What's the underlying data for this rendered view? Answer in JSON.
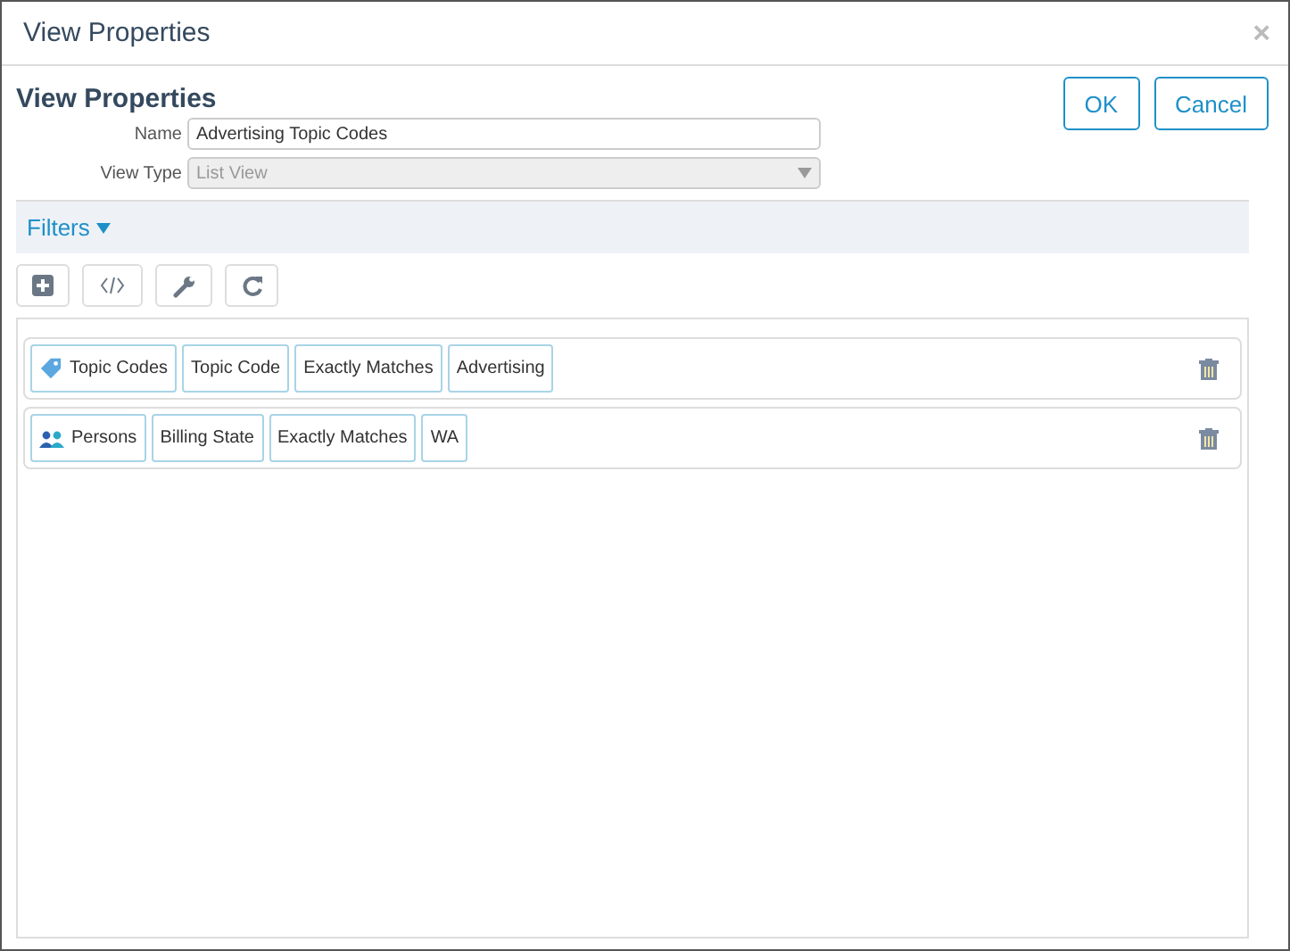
{
  "window": {
    "title": "View Properties",
    "close": "×"
  },
  "heading": "View Properties",
  "buttons": {
    "ok": "OK",
    "cancel": "Cancel"
  },
  "form": {
    "name": {
      "label": "Name",
      "value": "Advertising Topic Codes"
    },
    "view_type": {
      "label": "View Type",
      "value": "List View",
      "disabled": true
    }
  },
  "filters": {
    "title": "Filters",
    "expanded": true
  },
  "filter_rows": [
    {
      "entity": {
        "kind": "tag",
        "label": "Topic Codes"
      },
      "field": "Topic Code",
      "operator": "Exactly Matches",
      "value": "Advertising"
    },
    {
      "entity": {
        "kind": "persons",
        "label": "Persons"
      },
      "field": "Billing State",
      "operator": "Exactly Matches",
      "value": "WA"
    }
  ]
}
